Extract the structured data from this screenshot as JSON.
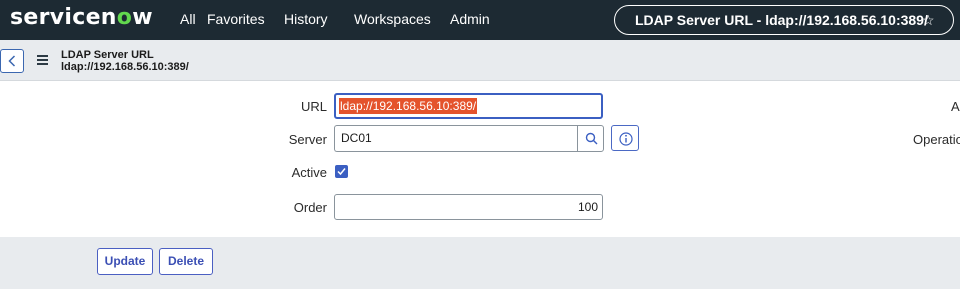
{
  "topnav": {
    "logo_text_a": "servicen",
    "logo_text_o": "o",
    "logo_text_b": "w",
    "items": [
      "All",
      "Favorites",
      "History",
      "Workspaces",
      "Admin"
    ],
    "record_title": "LDAP Server URL - ldap://192.168.56.10:389/",
    "star_glyph": "☆"
  },
  "header": {
    "title": "LDAP Server URL",
    "subtitle": "ldap://192.168.56.10:389/"
  },
  "form": {
    "url_label": "URL",
    "url_value": "ldap://192.168.56.10:389/",
    "server_label": "Server",
    "server_value": "DC01",
    "active_label": "Active",
    "active_checked": true,
    "order_label": "Order",
    "order_value": "100",
    "right_label_1": "A",
    "right_label_2": "Operatio"
  },
  "buttons": {
    "update": "Update",
    "delete": "Delete"
  },
  "colors": {
    "nav_bg": "#1d2a33",
    "accent": "#3b5fc2",
    "logo_o": "#62d84e",
    "selection": "#e4532c"
  }
}
